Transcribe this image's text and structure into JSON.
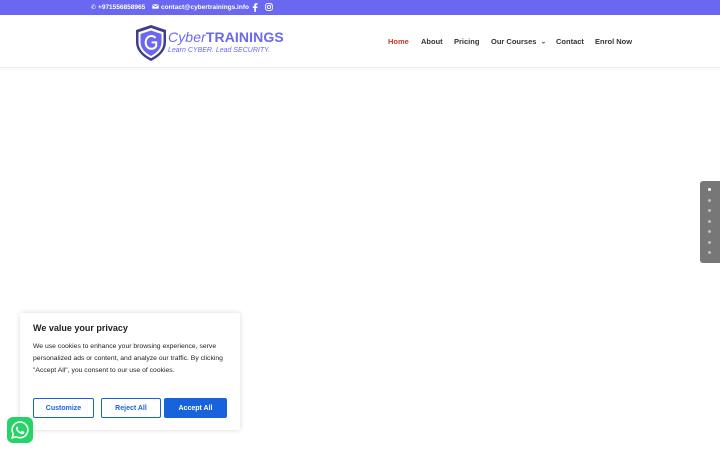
{
  "topbar": {
    "phone": "+971556858965",
    "email": "contact@cybertrainings.info",
    "social": [
      "facebook-icon",
      "instagram-icon"
    ],
    "bg_color": "#6a68f0"
  },
  "logo": {
    "brand_part1": "Cyber",
    "brand_part2": "TRAININGS",
    "tagline": "Learn CYBER. Lead SECURITY."
  },
  "nav": {
    "items": [
      {
        "label": "Home",
        "active": true
      },
      {
        "label": "About"
      },
      {
        "label": "Pricing"
      },
      {
        "label": "Our Courses",
        "dropdown": true
      },
      {
        "label": "Contact"
      },
      {
        "label": "Enrol Now"
      }
    ],
    "active_color": "#c0392b"
  },
  "slider": {
    "dot_count": 7,
    "active_index": 0
  },
  "cookie": {
    "title": "We value your privacy",
    "body": "We use cookies to enhance your browsing experience, serve personalized ads or content, and analyze our traffic. By clicking \"Accept All\", you consent to our use of cookies.",
    "customize_label": "Customize",
    "reject_label": "Reject All",
    "accept_label": "Accept All",
    "accent_color": "#1863dc"
  },
  "whatsapp": {
    "icon": "whatsapp-icon"
  }
}
